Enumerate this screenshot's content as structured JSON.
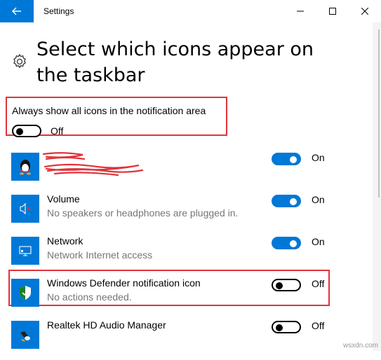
{
  "window": {
    "title": "Settings"
  },
  "page": {
    "title": "Select which icons appear on the taskbar"
  },
  "always_show": {
    "label": "Always show all icons in the notification area",
    "state": "Off",
    "enabled": false
  },
  "apps": [
    {
      "name": "",
      "description": "",
      "state": "On",
      "enabled": true,
      "icon": "qq-penguin-icon",
      "note": "text scribbled out in red"
    },
    {
      "name": "Volume",
      "description": "No speakers or headphones are plugged in.",
      "state": "On",
      "enabled": true,
      "icon": "volume-muted-icon"
    },
    {
      "name": "Network",
      "description": "Network Internet access",
      "state": "On",
      "enabled": true,
      "icon": "network-icon"
    },
    {
      "name": "Windows Defender notification icon",
      "description": "No actions needed.",
      "state": "Off",
      "enabled": false,
      "icon": "windows-defender-shield-icon"
    },
    {
      "name": "Realtek HD Audio Manager",
      "description": "",
      "state": "Off",
      "enabled": false,
      "icon": "realtek-speaker-icon"
    }
  ],
  "colors": {
    "accent": "#0078d7",
    "highlight_border": "#e0343a",
    "secondary_text": "#767676"
  },
  "watermark": "wsxdn.com"
}
